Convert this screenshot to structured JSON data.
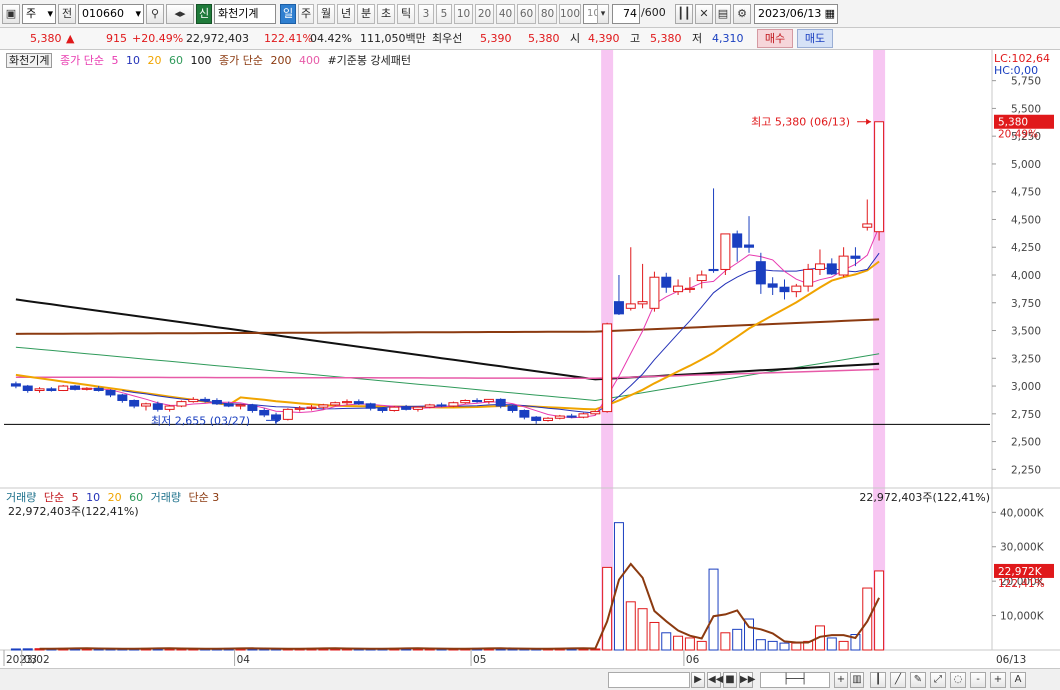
{
  "toolbar": {
    "market": "주",
    "prev_label": "전",
    "code": "010660",
    "badge": "신",
    "name": "화천기계",
    "period_tabs": [
      "일",
      "주",
      "월",
      "년",
      "분",
      "초",
      "틱"
    ],
    "active_period": "일",
    "numbers": [
      "3",
      "5",
      "10",
      "20",
      "40",
      "60",
      "80",
      "100"
    ],
    "count_select": "100",
    "count_current": "74",
    "count_total": "/600",
    "date": "2023/06/13"
  },
  "quote": {
    "price": "5,380",
    "change_sign": "▲",
    "change": "915",
    "change_pct": "+20.49%",
    "volume": "22,972,403",
    "volume_pct": "122.41%",
    "turnover": "04.42%",
    "amount": "111,050백만",
    "best_ask_label": "최우선",
    "best_ask": "5,390",
    "best_bid": "5,380",
    "open_label": "시",
    "open": "4,390",
    "high_label": "고",
    "high": "5,380",
    "low_label": "저",
    "low": "4,310",
    "buy_label": "매수",
    "sell_label": "매도"
  },
  "legend_price": {
    "stock": "화천기계",
    "ma_label": "종가 단순",
    "ma_periods": [
      "5",
      "10",
      "20",
      "60",
      "100"
    ],
    "ma2_label": "종가 단순",
    "ma2_periods": [
      "200",
      "400"
    ],
    "pattern": "#기준봉 강세패턴"
  },
  "legend_volume": {
    "label": "거래량",
    "ma_label": "단순",
    "ma_periods": [
      "5",
      "10",
      "20",
      "60"
    ],
    "label2": "거래량",
    "ma2_label": "단순 3",
    "sub_value": "22,972,403주(122,41%)",
    "right_value": "22,972,403주(122,41%)"
  },
  "price_axis": {
    "lc": "LC:102,64",
    "hc": "HC:0,00",
    "ticks": [
      "5,750",
      "5,500",
      "5,250",
      "5,000",
      "4,750",
      "4,500",
      "4,250",
      "4,000",
      "3,750",
      "3,500",
      "3,250",
      "3,000",
      "2,750",
      "2,500",
      "2,250"
    ],
    "last_price_tag": "5,380",
    "last_pct_tag": "20.49%"
  },
  "volume_axis": {
    "ticks": [
      "40,000K",
      "30,000K",
      "20,000K",
      "10,000K"
    ],
    "last_vol_tag": "22,972K",
    "last_vol_pct": "122,41%"
  },
  "annotations": {
    "high_label": "최고 5,380 (06/13)",
    "low_label": "최저 2,655 (03/27)"
  },
  "date_axis": {
    "labels": [
      "2023/02",
      "03",
      "04",
      "05",
      "06"
    ],
    "last_date": "06/13"
  },
  "colors": {
    "up": "#e0191b",
    "down": "#1a3fc0",
    "highlight": "#f7c6f2",
    "ma5": "#e83ab0",
    "ma10": "#2432b8",
    "ma20": "#f0a400",
    "ma60": "#2f9a5a",
    "ma100": "#111111",
    "ma200": "#8b3a10",
    "ma400": "#e75aa8"
  },
  "chart_data": {
    "type": "candlestick",
    "candles": [
      [
        0,
        3020,
        3040,
        2980,
        3000
      ],
      [
        1,
        3000,
        3010,
        2940,
        2960
      ],
      [
        2,
        2960,
        2990,
        2940,
        2975
      ],
      [
        3,
        2975,
        2990,
        2950,
        2960
      ],
      [
        4,
        2960,
        3010,
        2955,
        3000
      ],
      [
        5,
        3000,
        3010,
        2960,
        2970
      ],
      [
        6,
        2970,
        2990,
        2960,
        2980
      ],
      [
        7,
        2980,
        3000,
        2950,
        2960
      ],
      [
        8,
        2960,
        2970,
        2900,
        2920
      ],
      [
        9,
        2920,
        2930,
        2850,
        2870
      ],
      [
        10,
        2870,
        2880,
        2800,
        2820
      ],
      [
        11,
        2820,
        2850,
        2780,
        2840
      ],
      [
        12,
        2840,
        2860,
        2770,
        2790
      ],
      [
        13,
        2790,
        2830,
        2770,
        2820
      ],
      [
        14,
        2820,
        2870,
        2810,
        2860
      ],
      [
        15,
        2860,
        2900,
        2850,
        2880
      ],
      [
        16,
        2880,
        2900,
        2850,
        2870
      ],
      [
        17,
        2870,
        2890,
        2830,
        2840
      ],
      [
        18,
        2840,
        2860,
        2810,
        2820
      ],
      [
        19,
        2820,
        2840,
        2790,
        2830
      ],
      [
        20,
        2830,
        2840,
        2760,
        2780
      ],
      [
        21,
        2780,
        2800,
        2720,
        2740
      ],
      [
        22,
        2740,
        2760,
        2655,
        2700
      ],
      [
        23,
        2700,
        2800,
        2690,
        2790
      ],
      [
        24,
        2790,
        2820,
        2770,
        2800
      ],
      [
        25,
        2800,
        2830,
        2780,
        2810
      ],
      [
        26,
        2810,
        2840,
        2790,
        2830
      ],
      [
        27,
        2830,
        2860,
        2820,
        2850
      ],
      [
        28,
        2850,
        2880,
        2830,
        2860
      ],
      [
        29,
        2860,
        2880,
        2830,
        2840
      ],
      [
        30,
        2840,
        2850,
        2780,
        2800
      ],
      [
        31,
        2800,
        2810,
        2760,
        2780
      ],
      [
        32,
        2780,
        2820,
        2770,
        2810
      ],
      [
        33,
        2810,
        2830,
        2780,
        2790
      ],
      [
        34,
        2790,
        2820,
        2770,
        2810
      ],
      [
        35,
        2810,
        2840,
        2800,
        2830
      ],
      [
        36,
        2830,
        2850,
        2810,
        2820
      ],
      [
        37,
        2820,
        2860,
        2810,
        2850
      ],
      [
        38,
        2850,
        2880,
        2840,
        2870
      ],
      [
        39,
        2870,
        2890,
        2850,
        2860
      ],
      [
        40,
        2860,
        2880,
        2840,
        2880
      ],
      [
        41,
        2880,
        2890,
        2800,
        2820
      ],
      [
        42,
        2820,
        2830,
        2760,
        2780
      ],
      [
        43,
        2780,
        2790,
        2700,
        2720
      ],
      [
        44,
        2720,
        2730,
        2660,
        2690
      ],
      [
        45,
        2690,
        2720,
        2680,
        2710
      ],
      [
        46,
        2710,
        2740,
        2700,
        2730
      ],
      [
        47,
        2730,
        2750,
        2710,
        2720
      ],
      [
        48,
        2720,
        2760,
        2710,
        2750
      ],
      [
        49,
        2750,
        2780,
        2740,
        2770
      ],
      [
        50,
        2770,
        3570,
        2760,
        3560
      ],
      [
        51,
        3760,
        4000,
        3640,
        3650
      ],
      [
        52,
        3700,
        4250,
        3680,
        3740
      ],
      [
        53,
        3740,
        4100,
        3700,
        3760
      ],
      [
        54,
        3700,
        4030,
        3670,
        3980
      ],
      [
        55,
        3980,
        4020,
        3840,
        3890
      ],
      [
        56,
        3850,
        3960,
        3820,
        3900
      ],
      [
        57,
        3870,
        3980,
        3840,
        3880
      ],
      [
        58,
        3950,
        4040,
        3880,
        4000
      ],
      [
        59,
        4050,
        4780,
        4020,
        4040
      ],
      [
        60,
        4050,
        4280,
        4000,
        4370
      ],
      [
        61,
        4370,
        4400,
        4120,
        4250
      ],
      [
        62,
        4270,
        4530,
        4200,
        4250
      ],
      [
        63,
        4120,
        4200,
        3830,
        3920
      ],
      [
        64,
        3920,
        3980,
        3820,
        3890
      ],
      [
        65,
        3890,
        3960,
        3780,
        3850
      ],
      [
        66,
        3850,
        3920,
        3800,
        3900
      ],
      [
        67,
        3900,
        4100,
        3850,
        4050
      ],
      [
        68,
        4050,
        4230,
        4000,
        4100
      ],
      [
        69,
        4100,
        4150,
        4000,
        4010
      ],
      [
        70,
        4000,
        4250,
        3980,
        4170
      ],
      [
        71,
        4170,
        4250,
        4080,
        4150
      ],
      [
        72,
        4430,
        4680,
        4400,
        4460
      ],
      [
        73,
        4390,
        5380,
        4310,
        5380
      ]
    ],
    "volume_k": [],
    "ma5": [],
    "ma10": [],
    "ma20": [],
    "ma60": [],
    "ma100": [],
    "ma200": [],
    "ma400": []
  }
}
